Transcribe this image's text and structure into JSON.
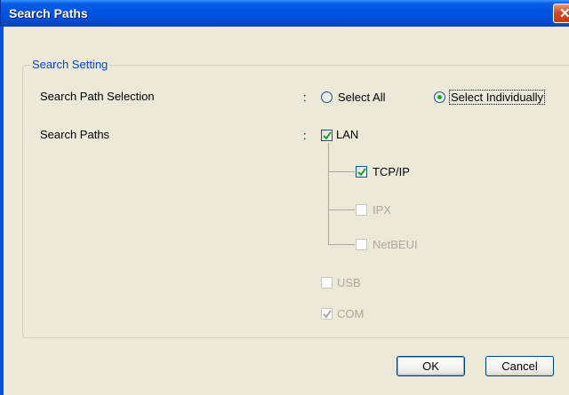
{
  "window": {
    "title": "Search Paths"
  },
  "group": {
    "title": "Search Setting"
  },
  "selection": {
    "label": "Search Path Selection",
    "colon": ":",
    "options": [
      {
        "label": "Select All",
        "checked": false
      },
      {
        "label": "Select Individually",
        "checked": true
      }
    ]
  },
  "paths": {
    "label": "Search Paths",
    "colon": ":",
    "items": {
      "lan": {
        "label": "LAN",
        "checked": true,
        "enabled": true
      },
      "tcpip": {
        "label": "TCP/IP",
        "checked": true,
        "enabled": true
      },
      "ipx": {
        "label": "IPX",
        "checked": false,
        "enabled": false
      },
      "netbeui": {
        "label": "NetBEUI",
        "checked": false,
        "enabled": false
      },
      "usb": {
        "label": "USB",
        "checked": false,
        "enabled": false
      },
      "com": {
        "label": "COM",
        "checked": true,
        "enabled": false
      }
    }
  },
  "buttons": {
    "ok": "OK",
    "cancel": "Cancel"
  },
  "colors": {
    "titlebar": "#0054e3",
    "group_label": "#0046d5",
    "disabled_text": "#aca899",
    "radio_dot": "#21a121",
    "check_mark": "#21a121"
  }
}
